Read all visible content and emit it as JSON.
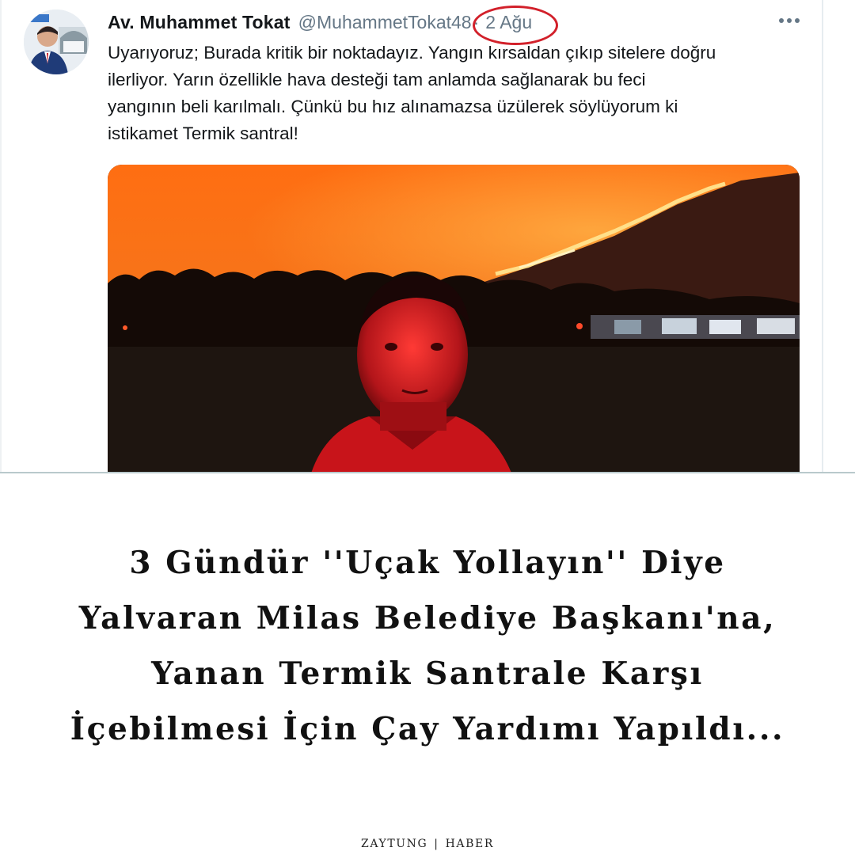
{
  "tweet": {
    "display_name": "Av. Muhammet Tokat",
    "handle": "@MuhammetTokat48",
    "separator": "·",
    "date": "2 Ağu",
    "text": "Uyarıyoruz; Burada kritik bir noktadayız. Yangın kırsaldan çıkıp sitelere doğru\nilerliyor. Yarın özellikle hava desteği tam anlamda sağlanarak bu feci\nyangının beli karılmalı. Çünkü bu hız alınamazsa üzülerek söylüyorum ki\nistikamet Termik santral!",
    "more_icon": "more-horizontal-icon",
    "annotation_color": "#d2202a"
  },
  "headline": {
    "lines": [
      "3 Gündür ''Uçak Yollayın'' Diye",
      "Yalvaran Milas Belediye Başkanı'na,",
      "Yanan Termik Santrale Karşı",
      "İçebilmesi İçin Çay Yardımı Yapıldı..."
    ]
  },
  "footer": {
    "brand": "ZAYTUNG",
    "separator": "|",
    "section": "HABER"
  },
  "colors": {
    "name": "#14171a",
    "muted": "#657786",
    "headline": "#111111",
    "divider": "#b9c9cc"
  }
}
